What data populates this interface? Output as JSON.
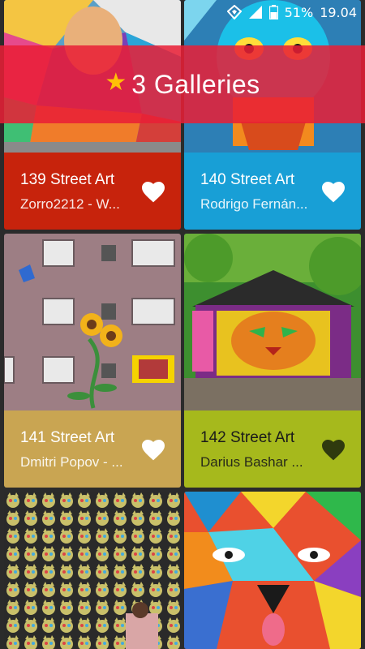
{
  "status": {
    "battery": "51%",
    "time": "19.04"
  },
  "header": {
    "star_icon": "star-icon",
    "title": "3 Galleries",
    "color": "#e91e36"
  },
  "cards": [
    {
      "name": "139 Street Art",
      "author": "Zorro2212 - W...",
      "color": "#c7230c",
      "favorite": false
    },
    {
      "name": "140 Street Art",
      "author": "Rodrigo Fernán...",
      "color": "#189fd6",
      "favorite": false
    },
    {
      "name": "141 Street Art",
      "author": "Dmitri Popov - ...",
      "color": "#c9a552",
      "favorite": false
    },
    {
      "name": "142 Street Art",
      "author": "Darius Bashar ...",
      "color": "#a6b91c",
      "favorite": true
    },
    {
      "name": "",
      "author": "",
      "color": "#3a3a3a",
      "favorite": false
    },
    {
      "name": "",
      "author": "",
      "color": "#3a3a3a",
      "favorite": false
    }
  ]
}
